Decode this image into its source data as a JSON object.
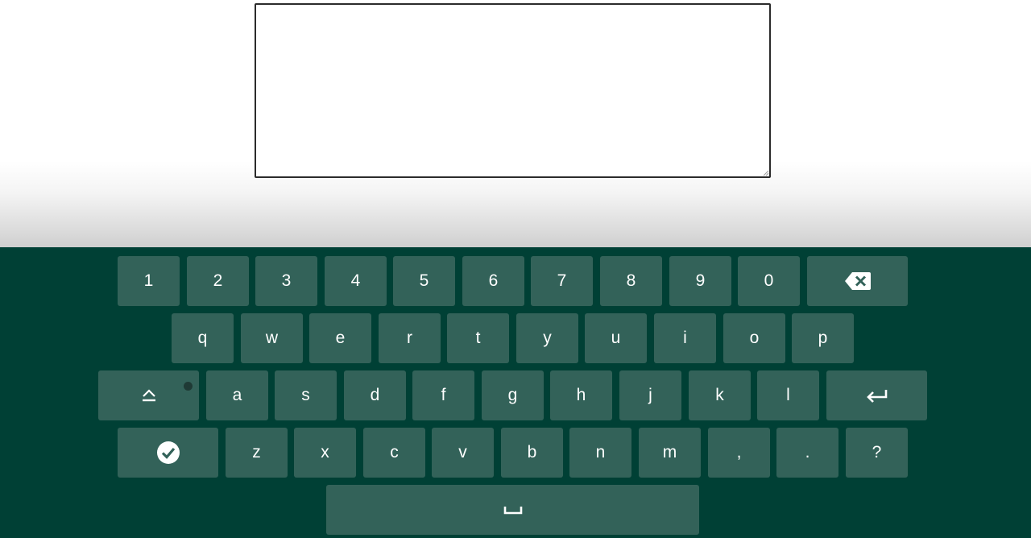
{
  "text_area": {
    "value": "",
    "placeholder": ""
  },
  "keyboard": {
    "colors": {
      "background": "#004035",
      "key": "#336259",
      "text": "#ffffff"
    },
    "row_numbers": [
      "1",
      "2",
      "3",
      "4",
      "5",
      "6",
      "7",
      "8",
      "9",
      "0"
    ],
    "row_top": [
      "q",
      "w",
      "e",
      "r",
      "t",
      "y",
      "u",
      "i",
      "o",
      "p"
    ],
    "row_home": [
      "a",
      "s",
      "d",
      "f",
      "g",
      "h",
      "j",
      "k",
      "l"
    ],
    "row_bottom": [
      "z",
      "x",
      "c",
      "v",
      "b",
      "n",
      "m",
      ",",
      ".",
      "?"
    ],
    "icons": {
      "backspace": "backspace-icon",
      "shift": "shift-icon",
      "enter": "enter-icon",
      "done": "checkmark-icon",
      "space": "space-icon"
    }
  }
}
